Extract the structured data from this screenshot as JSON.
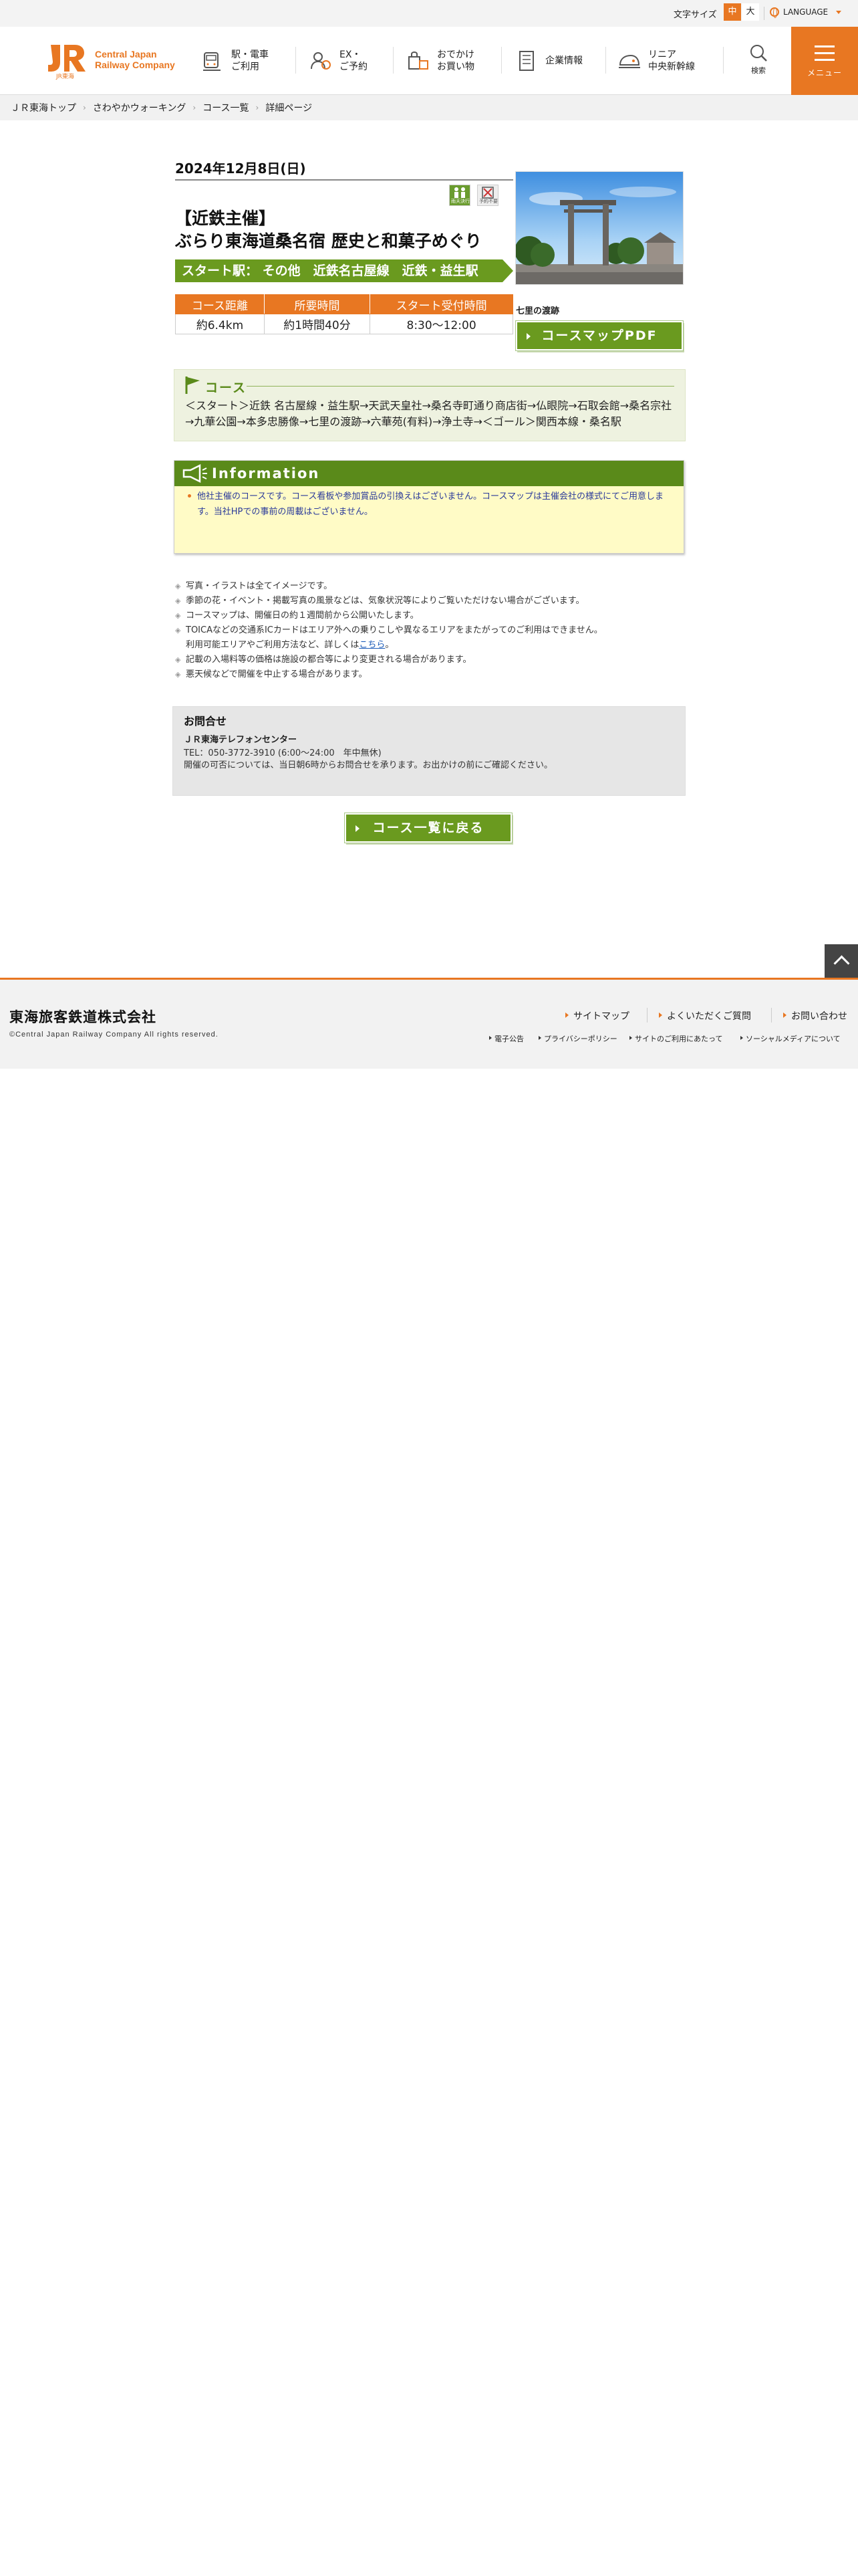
{
  "utility": {
    "font_size_label": "文字サイズ",
    "font_mid": "中",
    "font_large": "大",
    "language_label": "LANGUAGE"
  },
  "header": {
    "logo_text_line1": "Central Japan",
    "logo_text_line2": "Railway Company",
    "logo_sub": "JR東海",
    "nav": [
      {
        "line1": "駅・電車",
        "line2": "ご利用",
        "icon": "train-icon"
      },
      {
        "line1": "EX・",
        "line2": "ご予約",
        "icon": "ex-reservation-icon"
      },
      {
        "line1": "おでかけ",
        "line2": "お買い物",
        "icon": "shopping-icon"
      },
      {
        "line1": "企業情報",
        "line2": "",
        "icon": "building-icon"
      },
      {
        "line1": "リニア",
        "line2": "中央新幹線",
        "icon": "maglev-icon"
      }
    ],
    "search_label": "検索",
    "menu_label": "メニュー"
  },
  "breadcrumb": [
    "ＪＲ東海トップ",
    "さわやかウォーキング",
    "コース一覧",
    "詳細ページ"
  ],
  "event": {
    "date": "2024年12月8日(日)",
    "badge_a": "雨天決行",
    "badge_b": "予約不要",
    "title_line1": "【近鉄主催】",
    "title_line2": "ぶらり東海道桑名宿 歴史と和菓子めぐり",
    "start_station": "スタート駅： その他　近鉄名古屋線　近鉄・益生駅",
    "table_headers": [
      "コース距離",
      "所要時間",
      "スタート受付時間"
    ],
    "table_values": [
      "約6.4km",
      "約1時間40分",
      "8:30～12:00"
    ],
    "photo_caption": "七里の渡跡",
    "pdf_button": "コースマップPDF"
  },
  "course": {
    "heading": "コース",
    "route": "＜スタート＞近鉄 名古屋線・益生駅→天武天皇社→桑名寺町通り商店街→仏眼院→石取会館→桑名宗社→九華公園→本多忠勝像→七里の渡跡→六華苑(有料)→浄土寺→＜ゴール＞関西本線・桑名駅"
  },
  "information": {
    "heading": "Information",
    "text": "他社主催のコースです。コース看板や参加賞品の引換えはございません。コースマップは主催会社の様式にてご用意します。当社HPでの事前の周載はございません。"
  },
  "notes": [
    "写真・イラストは全てイメージです。",
    "季節の花・イベント・掲載写真の風景などは、気象状況等によりご覧いただけない場合がございます。",
    "コースマップは、開催日の約１週間前から公開いたします。",
    "TOICAなどの交通系ICカードはエリア外への乗りこしや異なるエリアをまたがってのご利用はできません。",
    "記載の入場料等の価格は施設の都合等により変更される場合があります。",
    "悪天候などで開催を中止する場合があります。"
  ],
  "note_continuation": "利用可能エリアやご利用方法など、詳しくは",
  "note_link": "こちら",
  "note_link_suffix": "。",
  "contact": {
    "heading": "お問合せ",
    "name": "ＪＲ東海テレフォンセンター",
    "tel": "TEL：050-3772-3910 (6:00～24:00　年中無休)",
    "note": "開催の可否については、当日朝6時からお問合せを承ります。お出かけの前にご確認ください。"
  },
  "back_button": "コース一覧に戻る",
  "footer": {
    "company": "東海旅客鉄道株式会社",
    "copyright": "©Central Japan Railway Company All rights reserved.",
    "links_main": [
      "サイトマップ",
      "よくいただくご質問",
      "お問い合わせ"
    ],
    "links_sub": [
      "電子公告",
      "プライバシーポリシー",
      "サイトのご利用にあたって",
      "ソーシャルメディアについて"
    ]
  },
  "colors": {
    "brand_orange": "#e87722",
    "green": "#6a9a1f",
    "info_yellow": "#fffbc6"
  }
}
